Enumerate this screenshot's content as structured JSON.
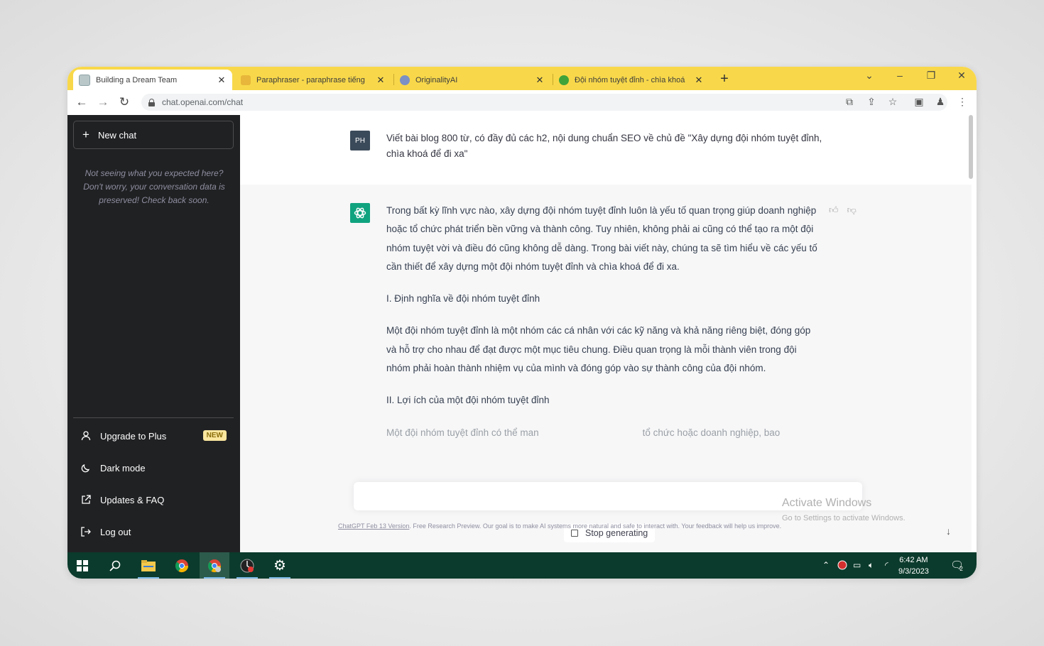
{
  "browser": {
    "tabs": [
      {
        "title": "Building a Dream Team",
        "active": true
      },
      {
        "title": "Paraphraser - paraphrase tiếng"
      },
      {
        "title": "OriginalityAI"
      },
      {
        "title": "Đội nhóm tuyệt đỉnh - chìa khoá"
      }
    ],
    "url": "chat.openai.com/chat"
  },
  "sidebar": {
    "new_chat": "New chat",
    "notice": "Not seeing what you expected here? Don't worry, your conversation data is preserved! Check back soon.",
    "items": [
      {
        "label": "Upgrade to Plus",
        "badge": "NEW"
      },
      {
        "label": "Dark mode"
      },
      {
        "label": "Updates & FAQ"
      },
      {
        "label": "Log out"
      }
    ]
  },
  "conversation": {
    "user_avatar": "PH",
    "user_message": "Viết bài blog 800 từ, có đầy đủ các h2, nội dung chuẩn SEO về chủ đề \"Xây dựng đội nhóm tuyệt đỉnh, chìa khoá để đi xa\"",
    "assistant_paragraphs": [
      "Trong bất kỳ lĩnh vực nào, xây dựng đội nhóm tuyệt đỉnh luôn là yếu tố quan trọng giúp doanh nghiệp hoặc tổ chức phát triển bền vững và thành công. Tuy nhiên, không phải ai cũng có thể tạo ra một đội nhóm tuyệt vời và điều đó cũng không dễ dàng. Trong bài viết này, chúng ta sẽ tìm hiểu về các yếu tố cần thiết để xây dựng một đội nhóm tuyệt đỉnh và chìa khoá để đi xa.",
      "I. Định nghĩa về đội nhóm tuyệt đỉnh",
      "Một đội nhóm tuyệt đỉnh là một nhóm các cá nhân với các kỹ năng và khả năng riêng biệt, đóng góp và hỗ trợ cho nhau để đạt được một mục tiêu chung. Điều quan trọng là mỗi thành viên trong đội nhóm phải hoàn thành nhiệm vụ của mình và đóng góp vào sự thành công của đội nhóm.",
      "II. Lợi ích của một đội nhóm tuyệt đỉnh"
    ],
    "partial_line_left": "Một đội nhóm tuyệt đỉnh có thể man",
    "partial_line_right": "tổ chức hoặc doanh nghiệp, bao",
    "stop_button": "Stop generating",
    "footer_link": "ChatGPT Feb 13 Version",
    "footer_text": ". Free Research Preview. Our goal is to make AI systems more natural and safe to interact with. Your feedback will help us improve."
  },
  "watermark": {
    "line1": "Activate Windows",
    "line2": "Go to Settings to activate Windows."
  },
  "taskbar": {
    "time": "6:42 AM",
    "date": "9/3/2023",
    "notifications": "2"
  }
}
